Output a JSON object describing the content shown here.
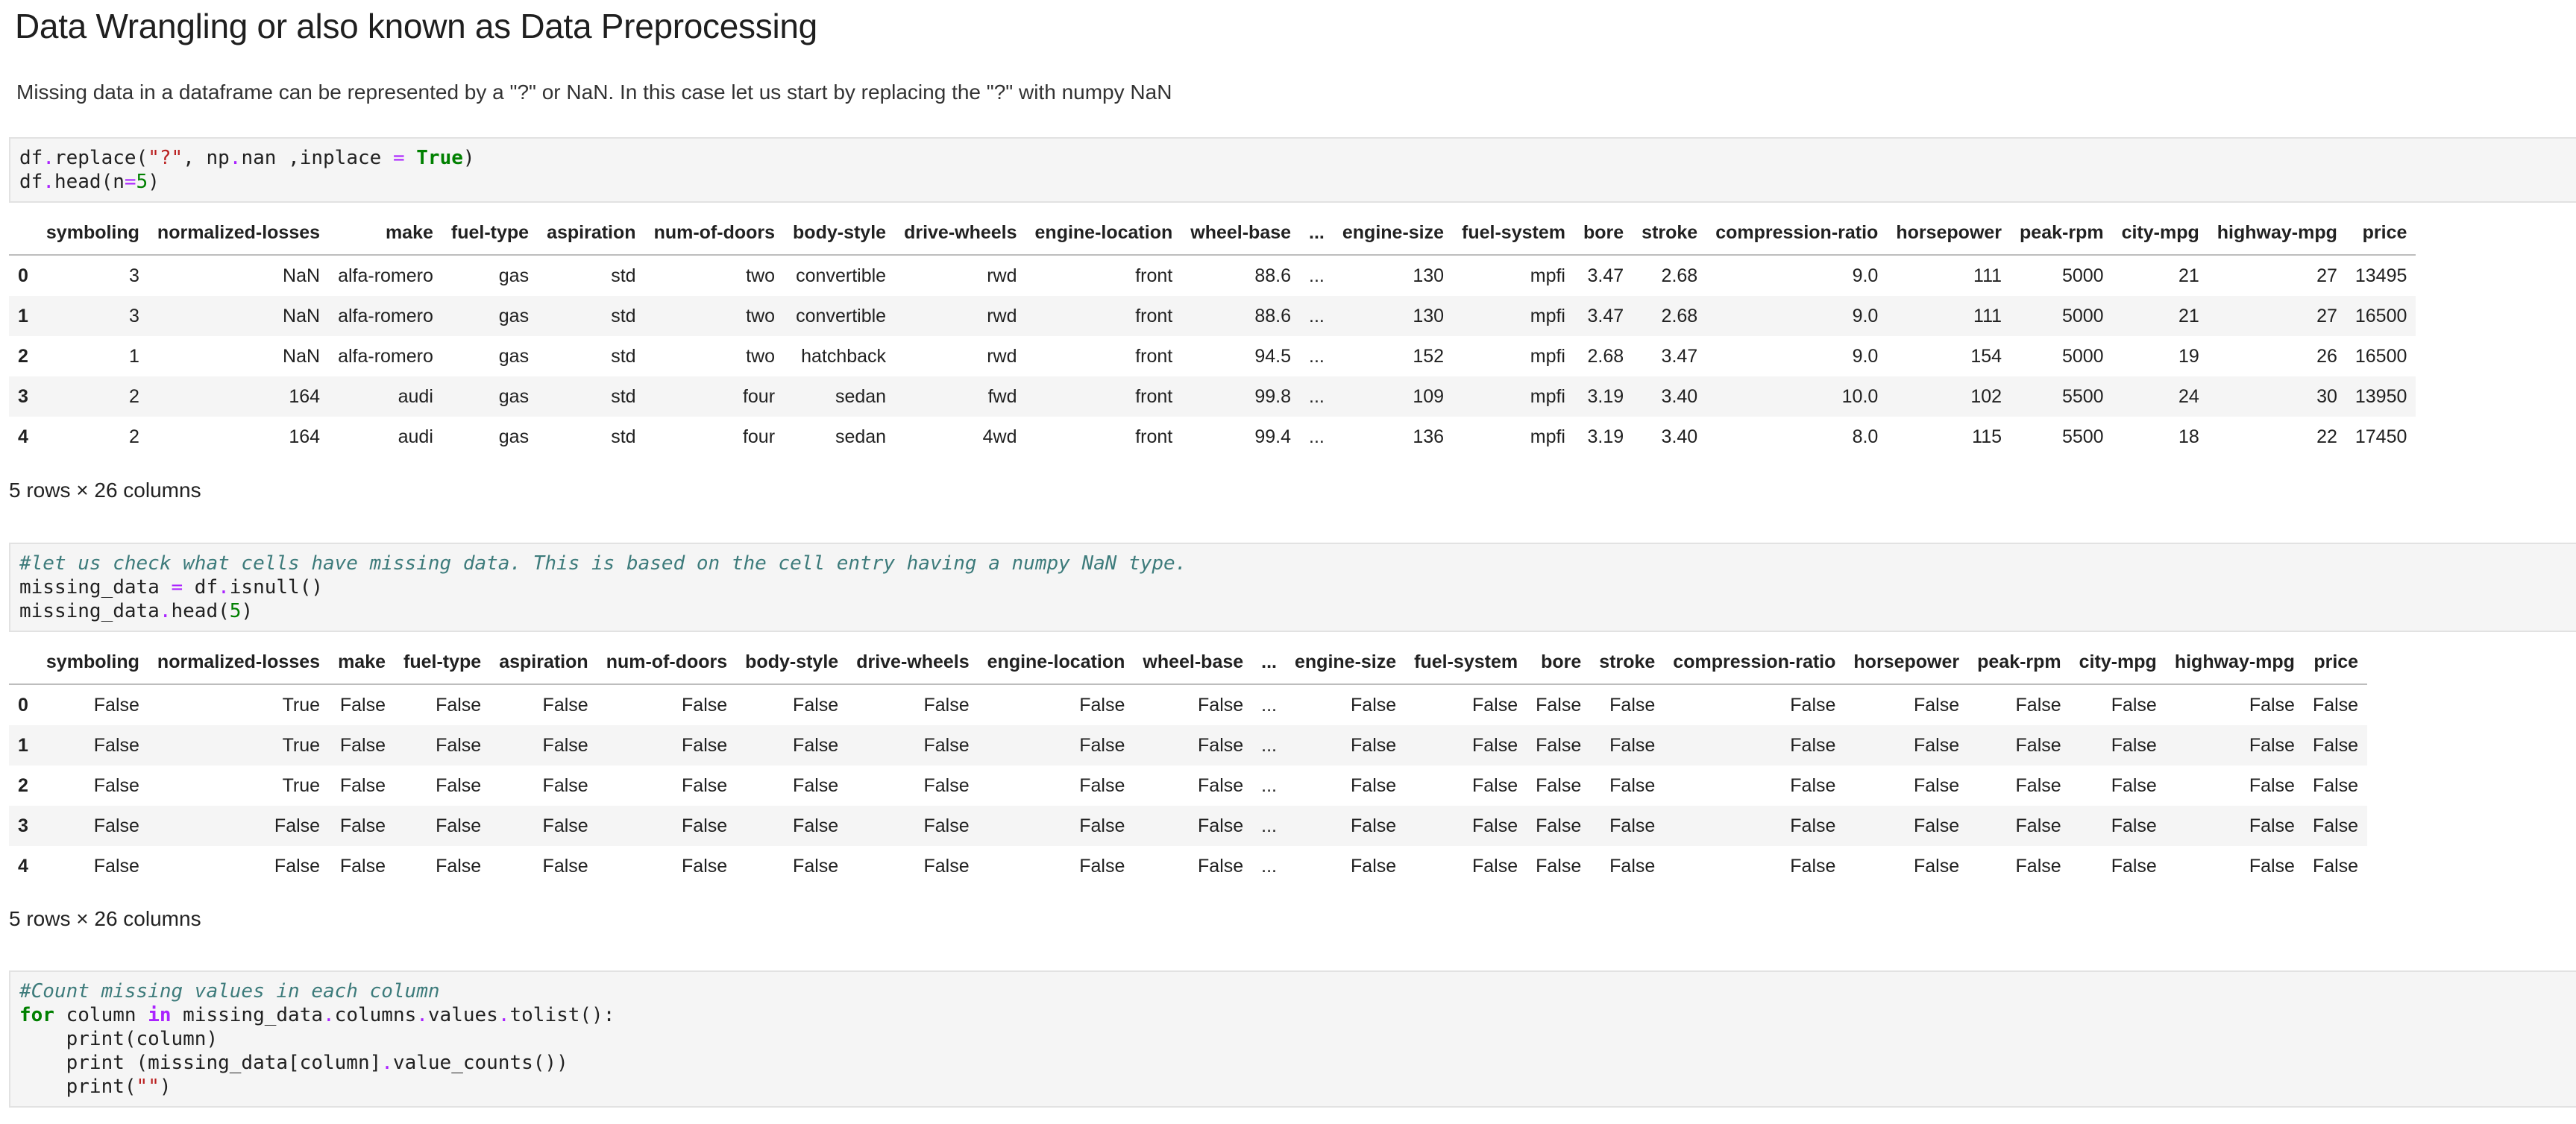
{
  "heading": "Data Wrangling or also known as Data Preprocessing",
  "intro": "Missing data in a dataframe can be represented by a \"?\" or NaN. In this case let us start by replacing the \"?\" with numpy NaN",
  "columns": [
    "",
    "symboling",
    "normalized-losses",
    "make",
    "fuel-type",
    "aspiration",
    "num-of-doors",
    "body-style",
    "drive-wheels",
    "engine-location",
    "wheel-base",
    "...",
    "engine-size",
    "fuel-system",
    "bore",
    "stroke",
    "compression-ratio",
    "horsepower",
    "peak-rpm",
    "city-mpg",
    "highway-mpg",
    "price"
  ],
  "table1": {
    "rows": [
      [
        "0",
        "3",
        "NaN",
        "alfa-romero",
        "gas",
        "std",
        "two",
        "convertible",
        "rwd",
        "front",
        "88.6",
        "...",
        "130",
        "mpfi",
        "3.47",
        "2.68",
        "9.0",
        "111",
        "5000",
        "21",
        "27",
        "13495"
      ],
      [
        "1",
        "3",
        "NaN",
        "alfa-romero",
        "gas",
        "std",
        "two",
        "convertible",
        "rwd",
        "front",
        "88.6",
        "...",
        "130",
        "mpfi",
        "3.47",
        "2.68",
        "9.0",
        "111",
        "5000",
        "21",
        "27",
        "16500"
      ],
      [
        "2",
        "1",
        "NaN",
        "alfa-romero",
        "gas",
        "std",
        "two",
        "hatchback",
        "rwd",
        "front",
        "94.5",
        "...",
        "152",
        "mpfi",
        "2.68",
        "3.47",
        "9.0",
        "154",
        "5000",
        "19",
        "26",
        "16500"
      ],
      [
        "3",
        "2",
        "164",
        "audi",
        "gas",
        "std",
        "four",
        "sedan",
        "fwd",
        "front",
        "99.8",
        "...",
        "109",
        "mpfi",
        "3.19",
        "3.40",
        "10.0",
        "102",
        "5500",
        "24",
        "30",
        "13950"
      ],
      [
        "4",
        "2",
        "164",
        "audi",
        "gas",
        "std",
        "four",
        "sedan",
        "4wd",
        "front",
        "99.4",
        "...",
        "136",
        "mpfi",
        "3.19",
        "3.40",
        "8.0",
        "115",
        "5500",
        "18",
        "22",
        "17450"
      ]
    ],
    "shape": "5 rows × 26 columns"
  },
  "table2": {
    "rows": [
      [
        "0",
        "False",
        "True",
        "False",
        "False",
        "False",
        "False",
        "False",
        "False",
        "False",
        "False",
        "...",
        "False",
        "False",
        "False",
        "False",
        "False",
        "False",
        "False",
        "False",
        "False",
        "False"
      ],
      [
        "1",
        "False",
        "True",
        "False",
        "False",
        "False",
        "False",
        "False",
        "False",
        "False",
        "False",
        "...",
        "False",
        "False",
        "False",
        "False",
        "False",
        "False",
        "False",
        "False",
        "False",
        "False"
      ],
      [
        "2",
        "False",
        "True",
        "False",
        "False",
        "False",
        "False",
        "False",
        "False",
        "False",
        "False",
        "...",
        "False",
        "False",
        "False",
        "False",
        "False",
        "False",
        "False",
        "False",
        "False",
        "False"
      ],
      [
        "3",
        "False",
        "False",
        "False",
        "False",
        "False",
        "False",
        "False",
        "False",
        "False",
        "False",
        "...",
        "False",
        "False",
        "False",
        "False",
        "False",
        "False",
        "False",
        "False",
        "False",
        "False"
      ],
      [
        "4",
        "False",
        "False",
        "False",
        "False",
        "False",
        "False",
        "False",
        "False",
        "False",
        "False",
        "...",
        "False",
        "False",
        "False",
        "False",
        "False",
        "False",
        "False",
        "False",
        "False",
        "False"
      ]
    ],
    "shape": "5 rows × 26 columns"
  },
  "cell1": {
    "l1_a": "df",
    "l1_b": ".",
    "l1_c": "replace(",
    "l1_str": "\"?\"",
    "l1_d": ", np",
    "l1_e": ".",
    "l1_f": "nan ,inplace ",
    "l1_g": "=",
    "l1_h": " ",
    "l1_kw": "True",
    "l1_i": ")",
    "l2_a": "df",
    "l2_b": ".",
    "l2_c": "head(n",
    "l2_d": "=",
    "l2_num": "5",
    "l2_e": ")"
  },
  "cell2": {
    "comment": "#let us check what cells have missing data. This is based on the cell entry having a numpy NaN type.",
    "l2_a": "missing_data ",
    "l2_b": "=",
    "l2_c": " df",
    "l2_d": ".",
    "l2_e": "isnull()",
    "l3_a": "missing_data",
    "l3_b": ".",
    "l3_c": "head(",
    "l3_num": "5",
    "l3_d": ")"
  },
  "cell3": {
    "comment": "#Count missing values in each column",
    "l2_for": "for",
    "l2_a": " column ",
    "l2_in": "in",
    "l2_b": " missing_data",
    "l2_c": ".",
    "l2_d": "columns",
    "l2_e": ".",
    "l2_f": "values",
    "l2_g": ".",
    "l2_h": "tolist():",
    "l3": "    print(column)",
    "l4_a": "    print (missing_data[column]",
    "l4_b": ".",
    "l4_c": "value_counts())",
    "l5_a": "    print(",
    "l5_str": "\"\"",
    "l5_b": ")"
  }
}
